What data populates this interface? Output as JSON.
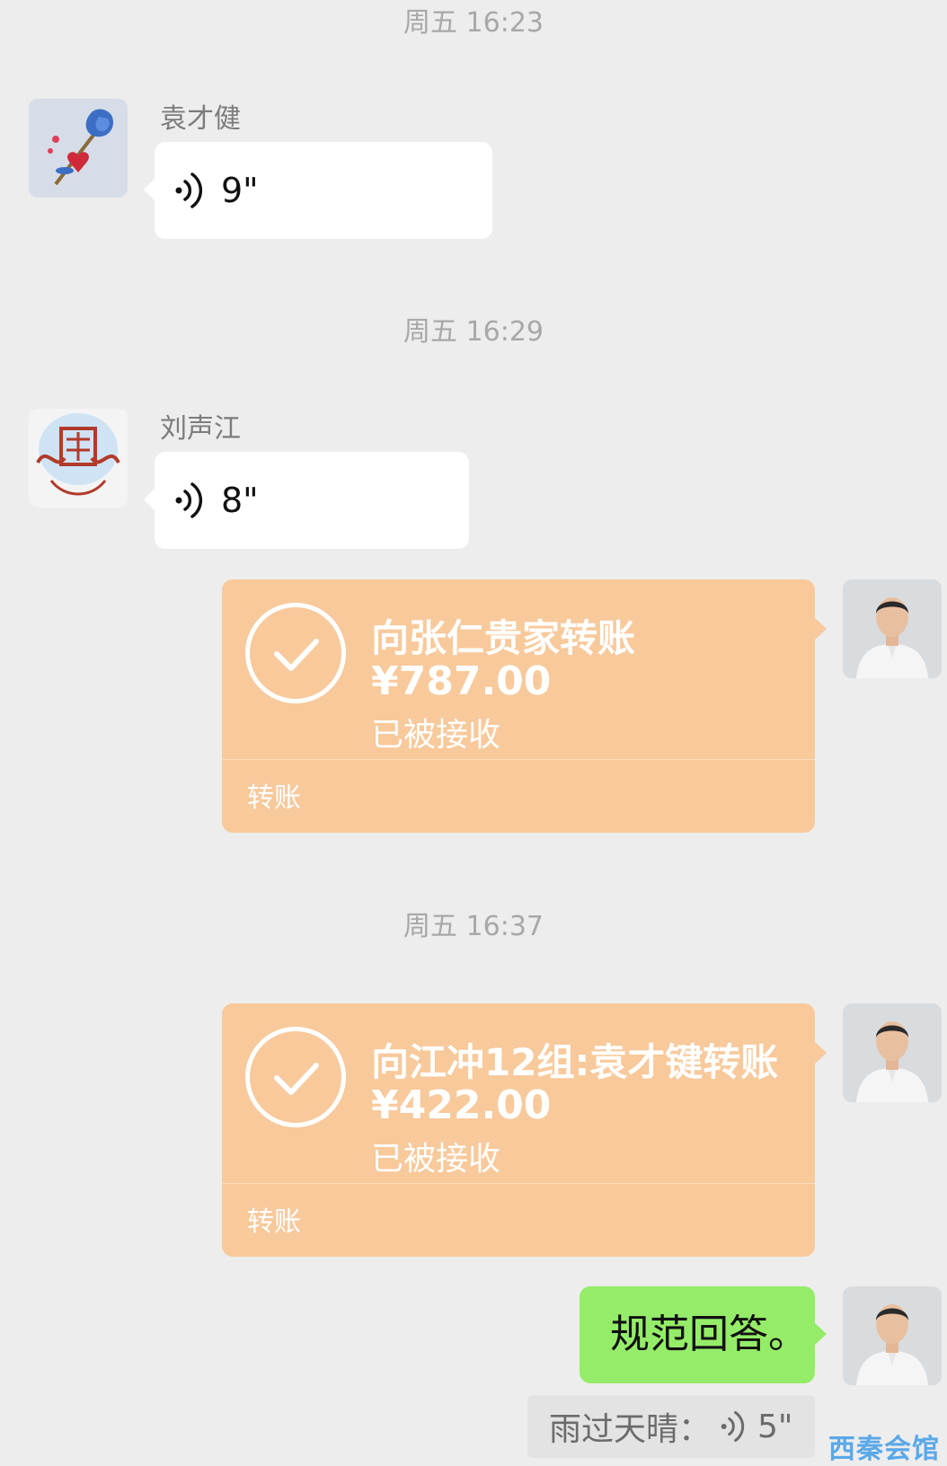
{
  "messages": {
    "t1": "周五 16:23",
    "m1": {
      "sender": "袁才健",
      "duration": "9\""
    },
    "t2": "周五 16:29",
    "m2": {
      "sender": "刘声江",
      "duration": "8\""
    },
    "transfer1": {
      "title": "向张仁贵家转账",
      "amount": "¥787.00",
      "status": "已被接收",
      "footer": "转账"
    },
    "t3": "周五 16:37",
    "transfer2": {
      "title": "向江冲12组:袁才键转账",
      "amount": "¥422.00",
      "status": "已被接收",
      "footer": "转账"
    },
    "reply": {
      "text": "规范回答。"
    },
    "quote": {
      "label": "雨过天晴：",
      "duration": "5\""
    }
  },
  "avatars": {
    "yuan": "rose-heart-avatar",
    "liu": "liu-seal-avatar",
    "self": "man-white-shirt-avatar"
  },
  "watermark": "西秦会馆",
  "colors": {
    "background": "#ededed",
    "transfer": "#f8c99b",
    "sent": "#95ec69",
    "watermark": "#5aa8e8"
  }
}
